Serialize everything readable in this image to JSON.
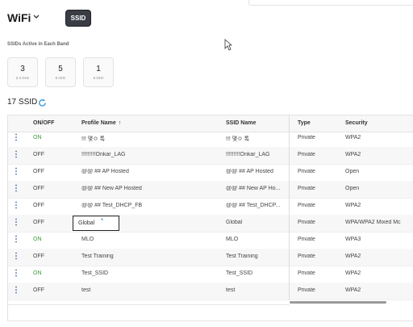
{
  "header": {
    "title": "WiFi",
    "chevron_icon": "chevron-down-icon",
    "ssid_button": "SSID"
  },
  "bands": {
    "label": "SSIDs Active in Each Band",
    "items": [
      {
        "count": "3",
        "name": "2.4 GHz"
      },
      {
        "count": "5",
        "name": "5 GHz"
      },
      {
        "count": "1",
        "name": "6 GHz"
      }
    ]
  },
  "summary": {
    "count_label": "17 SSID",
    "refresh_icon": "refresh-icon"
  },
  "table": {
    "headers": {
      "onoff": "ON/OFF",
      "profile": "Profile Name",
      "ssid": "SSID Name",
      "type": "Type",
      "security": "Security"
    },
    "rows": [
      {
        "state": "ON",
        "profile": "!!! 몇ㅇ 톡",
        "ssid": "!!! 몇ㅇ 톡",
        "type": "Private",
        "security": "WPA2"
      },
      {
        "state": "OFF",
        "profile": "!!!!!!!!!Onkar_LAG",
        "ssid": "!!!!!!!!!Onkar_LAG",
        "type": "Private",
        "security": "WPA2"
      },
      {
        "state": "OFF",
        "profile": "@@ ## AP Hosted",
        "ssid": "@@ ## AP Hosted",
        "type": "Private",
        "security": "Open"
      },
      {
        "state": "OFF",
        "profile": "@@ ## New AP Hosted",
        "ssid": "@@ ## New AP Ho...",
        "type": "Private",
        "security": "Open"
      },
      {
        "state": "OFF",
        "profile": "@@ ## Test_DHCP_FB",
        "ssid": "@@ ## Test_DHCP...",
        "type": "Private",
        "security": "WPA2"
      },
      {
        "state": "OFF",
        "profile": "Global",
        "ssid": "Global",
        "type": "Private",
        "security": "WPA/WPA2 Mixed Mc"
      },
      {
        "state": "ON",
        "profile": "MLO",
        "ssid": "MLO",
        "type": "Private",
        "security": "WPA3"
      },
      {
        "state": "OFF",
        "profile": "Test Training",
        "ssid": "Test Training",
        "type": "Private",
        "security": "WPA2"
      },
      {
        "state": "ON",
        "profile": "Test_SSID",
        "ssid": "Test_SSID",
        "type": "Private",
        "security": "WPA2"
      },
      {
        "state": "OFF",
        "profile": "test",
        "ssid": "test",
        "type": "Private",
        "security": "WPA2"
      }
    ]
  },
  "colors": {
    "on": "#3a9d3a",
    "off": "#444444",
    "kebab": "#2b5cab",
    "ssid_button_bg": "#3a3d44"
  }
}
